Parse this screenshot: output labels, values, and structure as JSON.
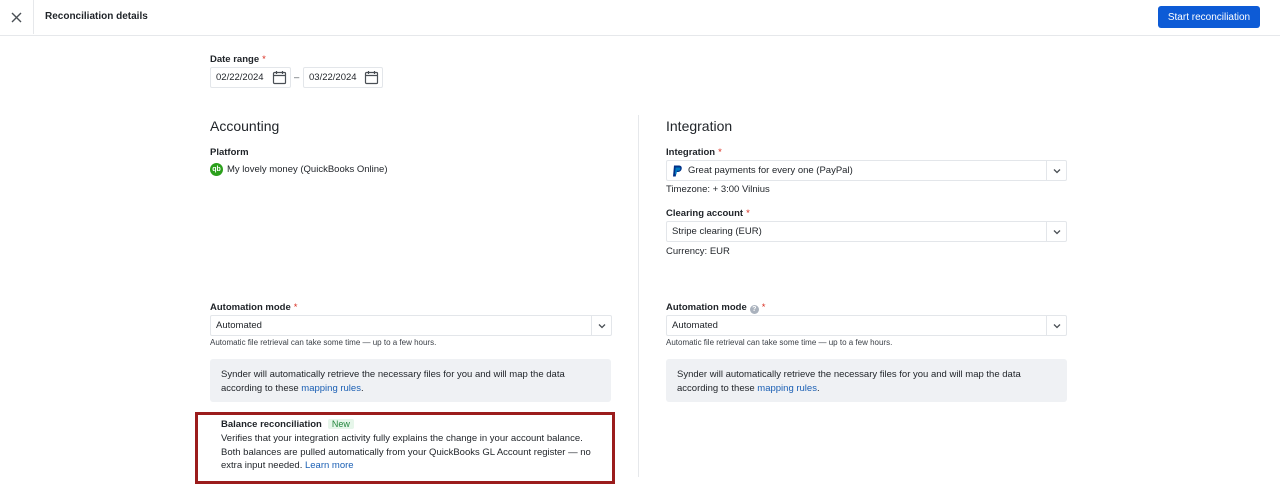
{
  "header": {
    "title": "Reconciliation details",
    "start_button": "Start reconciliation"
  },
  "date_range": {
    "label": "Date range",
    "required_mark": "*",
    "from": "02/22/2024",
    "separator": "–",
    "to": "03/22/2024"
  },
  "accounting": {
    "title": "Accounting",
    "platform_label": "Platform",
    "platform_icon_text": "qb",
    "platform_value": "My lovely money (QuickBooks Online)",
    "automation_label": "Automation mode",
    "automation_required": "*",
    "automation_value": "Automated",
    "automation_hint": "Automatic file retrieval can take some time — up to a few hours.",
    "info_text": "Synder will automatically retrieve the necessary files for you and will map the data according to these ",
    "info_link": "mapping rules",
    "info_end": "."
  },
  "integration": {
    "title": "Integration",
    "integration_label": "Integration",
    "integration_required": "*",
    "integration_value": "Great payments for every one (PayPal)",
    "timezone": "Timezone: + 3:00 Vilnius",
    "clearing_label": "Clearing account",
    "clearing_required": "*",
    "clearing_value": "Stripe clearing (EUR)",
    "currency": "Currency: EUR",
    "automation_label": "Automation mode",
    "automation_help": "?",
    "automation_required": "*",
    "automation_value": "Automated",
    "automation_hint": "Automatic file retrieval can take some time — up to a few hours.",
    "info_text": "Synder will automatically retrieve the necessary files for you and will map the data according to these ",
    "info_link": "mapping rules",
    "info_end": "."
  },
  "balance": {
    "title": "Balance reconciliation",
    "badge": "New",
    "description": "Verifies that your integration activity fully explains the change in your account balance. Both balances are pulled automatically from your QuickBooks GL Account register — no extra input needed. ",
    "link": "Learn more"
  },
  "colors": {
    "primary": "#0d5bd6",
    "link": "#1a5fb4",
    "highlight_frame": "#9b1c1c",
    "badge_green": "#23863d"
  }
}
